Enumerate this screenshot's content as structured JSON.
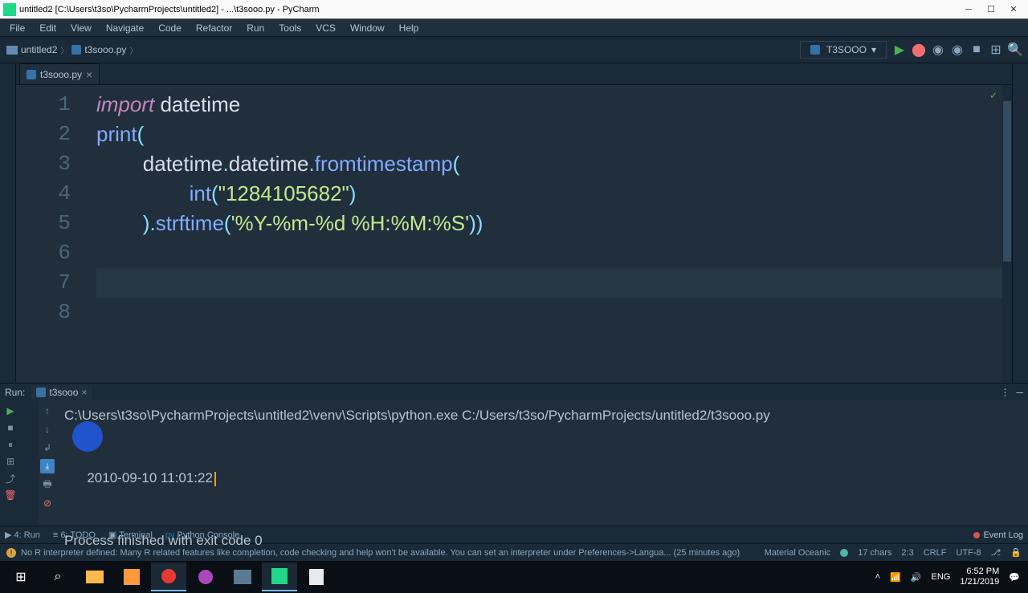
{
  "window": {
    "title": "untitled2 [C:\\Users\\t3so\\PycharmProjects\\untitled2] - ...\\t3sooo.py - PyCharm"
  },
  "menubar": [
    "File",
    "Edit",
    "View",
    "Navigate",
    "Code",
    "Refactor",
    "Run",
    "Tools",
    "VCS",
    "Window",
    "Help"
  ],
  "breadcrumb": {
    "project": "untitled2",
    "file": "t3sooo.py"
  },
  "run_config": {
    "name": "T3SOOO"
  },
  "tab": {
    "name": "t3sooo.py"
  },
  "code": {
    "lines": [
      "1",
      "2",
      "3",
      "4",
      "5",
      "6",
      "7",
      "8"
    ],
    "l1a": "import",
    "l1b": " datetime",
    "l2a": "print",
    "l2b": "(",
    "l3a": "        datetime",
    "l3b": ".",
    "l3c": "datetime",
    "l3d": ".",
    "l3e": "fromtimestamp",
    "l3f": "(",
    "l4a": "                int",
    "l4b": "(",
    "l4c": "\"1284105682\"",
    "l4d": ")",
    "l5a": "        )",
    "l5b": ".",
    "l5c": "strftime",
    "l5d": "(",
    "l5e": "'%Y-%m-%d %H:%M:%S'",
    "l5f": "))"
  },
  "run_panel": {
    "label": "Run:",
    "tab_name": "t3sooo",
    "cmd": "C:\\Users\\t3so\\PycharmProjects\\untitled2\\venv\\Scripts\\python.exe C:/Users/t3so/PycharmProjects/untitled2/t3sooo.py",
    "output": "2010-09-10 11:01:22",
    "exit": "Process finished with exit code 0"
  },
  "bottom_tabs": {
    "run": "4: Run",
    "todo": "6: TODO",
    "terminal": "Terminal",
    "python_console": "Python Console",
    "event_log": "Event Log"
  },
  "status": {
    "msg": "No R interpreter defined: Many R related features like completion, code checking and help won't be available. You can set an interpreter under Preferences->Langua... (25 minutes ago)",
    "theme": "Material Oceanic",
    "chars": "17 chars",
    "pos": "2:3",
    "crlf": "CRLF",
    "enc": "UTF-8",
    "git": "⎇"
  },
  "systray": {
    "lang": "ENG",
    "time": "6:52 PM",
    "date": "1/21/2019"
  }
}
